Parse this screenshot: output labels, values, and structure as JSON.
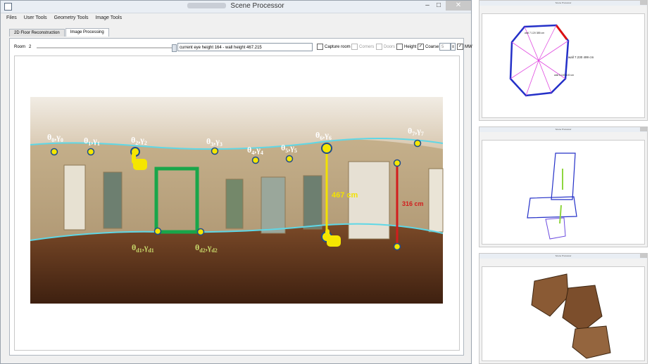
{
  "window": {
    "title": "Scene Processor",
    "buttons": {
      "minimize": "–",
      "maximize": "□",
      "close": "✕"
    }
  },
  "menu": [
    "Files",
    "User Tools",
    "Geometry Tools",
    "Image Tools"
  ],
  "tabs": [
    {
      "label": "2D Floor Reconstruction",
      "active": false
    },
    {
      "label": "Image Processing",
      "active": true
    }
  ],
  "controls": {
    "room_label": "Room",
    "room_value": "2",
    "status": "current eye height 164 - wall height 467.215",
    "checkboxes": [
      {
        "label": "Capture room",
        "checked": false,
        "enabled": true
      },
      {
        "label": "Corners",
        "checked": false,
        "enabled": false
      },
      {
        "label": "Doors",
        "checked": false,
        "enabled": false
      },
      {
        "label": "Height",
        "checked": false,
        "enabled": true
      },
      {
        "label": "Coarse",
        "checked": true,
        "enabled": true
      },
      {
        "label": "MW",
        "checked": true,
        "enabled": true
      }
    ],
    "coarse_value": "5"
  },
  "panorama": {
    "corner_labels": [
      {
        "theta": "θ",
        "sub": "0",
        "gamma": "γ",
        "gsub": "0"
      },
      {
        "theta": "θ",
        "sub": "1",
        "gamma": "γ",
        "gsub": "1"
      },
      {
        "theta": "θ",
        "sub": "2",
        "gamma": "γ",
        "gsub": "2"
      },
      {
        "theta": "θ",
        "sub": "3",
        "gamma": "γ",
        "gsub": "3"
      },
      {
        "theta": "θ",
        "sub": "4",
        "gamma": "γ",
        "gsub": "4"
      },
      {
        "theta": "θ",
        "sub": "5",
        "gamma": "γ",
        "gsub": "5"
      },
      {
        "theta": "θ",
        "sub": "6",
        "gamma": "γ",
        "gsub": "6"
      },
      {
        "theta": "θ",
        "sub": "7",
        "gamma": "γ",
        "gsub": "7"
      }
    ],
    "door_labels": [
      {
        "theta": "θ",
        "sub": "d1",
        "gamma": "γ",
        "gsub": "d1"
      },
      {
        "theta": "θ",
        "sub": "d2",
        "gamma": "γ",
        "gsub": "d2"
      }
    ],
    "height_label": "467 cm",
    "wall_label": "316 cm",
    "colors": {
      "ceiling_line": "#5fd7e6",
      "handle": "#f5e600",
      "door_frame": "#19a64a",
      "height_marker": "#f2e200",
      "wall_marker": "#d21d1d",
      "door_label": "#c8d86a"
    }
  },
  "thumbnails": [
    {
      "title": "Scene Processor",
      "content": "2D floor plan",
      "labels": [
        "wall 7.230 499 cm",
        "wall 5.163 100 cm",
        "wall 7.120 385 cm"
      ]
    },
    {
      "title": "Scene Processor",
      "content": "Multi-room layout"
    },
    {
      "title": "Scene Processor",
      "content": "3D model"
    }
  ]
}
